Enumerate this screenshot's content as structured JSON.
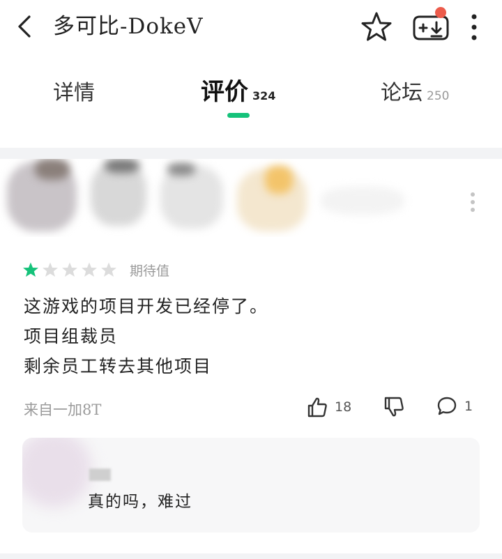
{
  "header": {
    "title": "多可比-DokeV",
    "has_notification": true
  },
  "tabs": [
    {
      "label": "详情",
      "count": ""
    },
    {
      "label": "评价",
      "count": "324"
    },
    {
      "label": "论坛",
      "count": "250"
    }
  ],
  "active_tab": "评价",
  "review": {
    "rating": 1,
    "max_rating": 5,
    "rating_label": "期待值",
    "lines": [
      "这游戏的项目开发已经停了。",
      "项目组裁员",
      "剩余员工转去其他项目"
    ],
    "device": "来自一加8T",
    "likes": "18",
    "comments": "1"
  },
  "reply": {
    "text": "真的吗，难过"
  },
  "colors": {
    "accent": "#15c27a",
    "notification": "#ec5b4b",
    "muted_text": "#9a9a9a",
    "reply_bg": "#f7f7f8"
  }
}
